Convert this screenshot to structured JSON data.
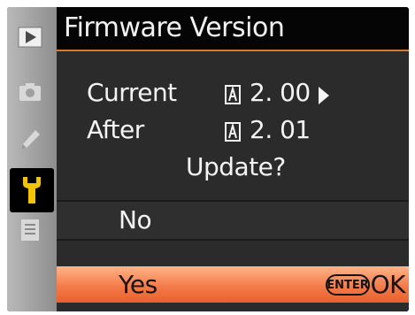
{
  "title": "Firmware Version",
  "firmware": {
    "current_label": "Current",
    "current_value": "2. 00",
    "after_label": "After",
    "after_value": "2. 01",
    "prompt": "Update?"
  },
  "options": {
    "no_label": "No",
    "yes_label": "Yes",
    "enter_label": "ENTER",
    "ok_label": "OK"
  },
  "sidebar": {
    "items": [
      {
        "icon": "playback-icon"
      },
      {
        "icon": "camera-icon"
      },
      {
        "icon": "pencil-icon"
      },
      {
        "icon": "wrench-icon",
        "active": true
      },
      {
        "icon": "list-icon"
      }
    ]
  },
  "colors": {
    "accent": "#d97a2b",
    "selected_top": "#ffb489",
    "selected_bottom": "#e8612e",
    "wrench": "#f5c400"
  }
}
